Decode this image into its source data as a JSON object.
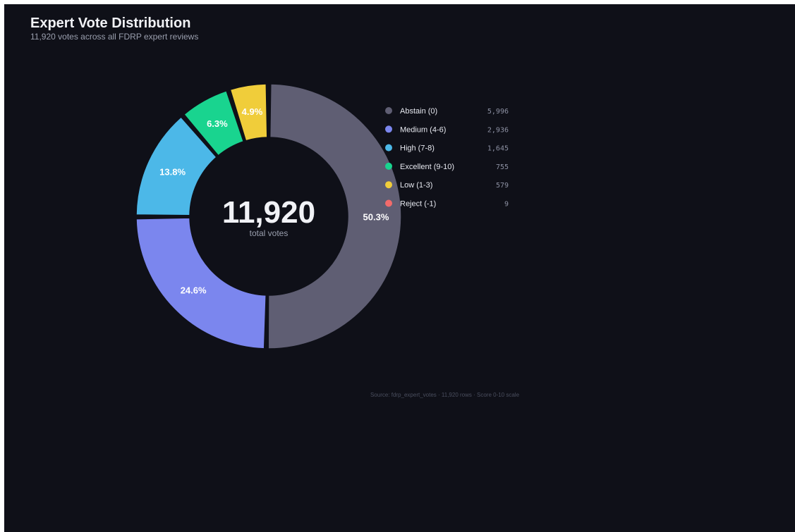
{
  "chart_data": {
    "type": "pie",
    "title": "Expert Vote Distribution",
    "subtitle": "11,920 votes across all FDRP expert reviews",
    "center_value": "11,920",
    "center_label": "total votes",
    "slices": [
      {
        "label": "Abstain (0)",
        "value": 5996,
        "value_text": "5,996",
        "percent": "50.3%",
        "color": "#5f5e73"
      },
      {
        "label": "Medium (4-6)",
        "value": 2936,
        "value_text": "2,936",
        "percent": "24.6%",
        "color": "#7b86ee"
      },
      {
        "label": "High (7-8)",
        "value": 1645,
        "value_text": "1,645",
        "percent": "13.8%",
        "color": "#4cb8e8"
      },
      {
        "label": "Excellent (9-10)",
        "value": 755,
        "value_text": "755",
        "percent": "6.3%",
        "color": "#19d48f"
      },
      {
        "label": "Low (1-3)",
        "value": 579,
        "value_text": "579",
        "percent": "4.9%",
        "color": "#f0cd3a"
      },
      {
        "label": "Reject (-1)",
        "value": 9,
        "value_text": "9",
        "percent": "",
        "color": "#f26b6b"
      }
    ],
    "legend_position": "right",
    "source": "Source: fdrp_expert_votes · 11,920 rows · Score 0-10 scale"
  }
}
